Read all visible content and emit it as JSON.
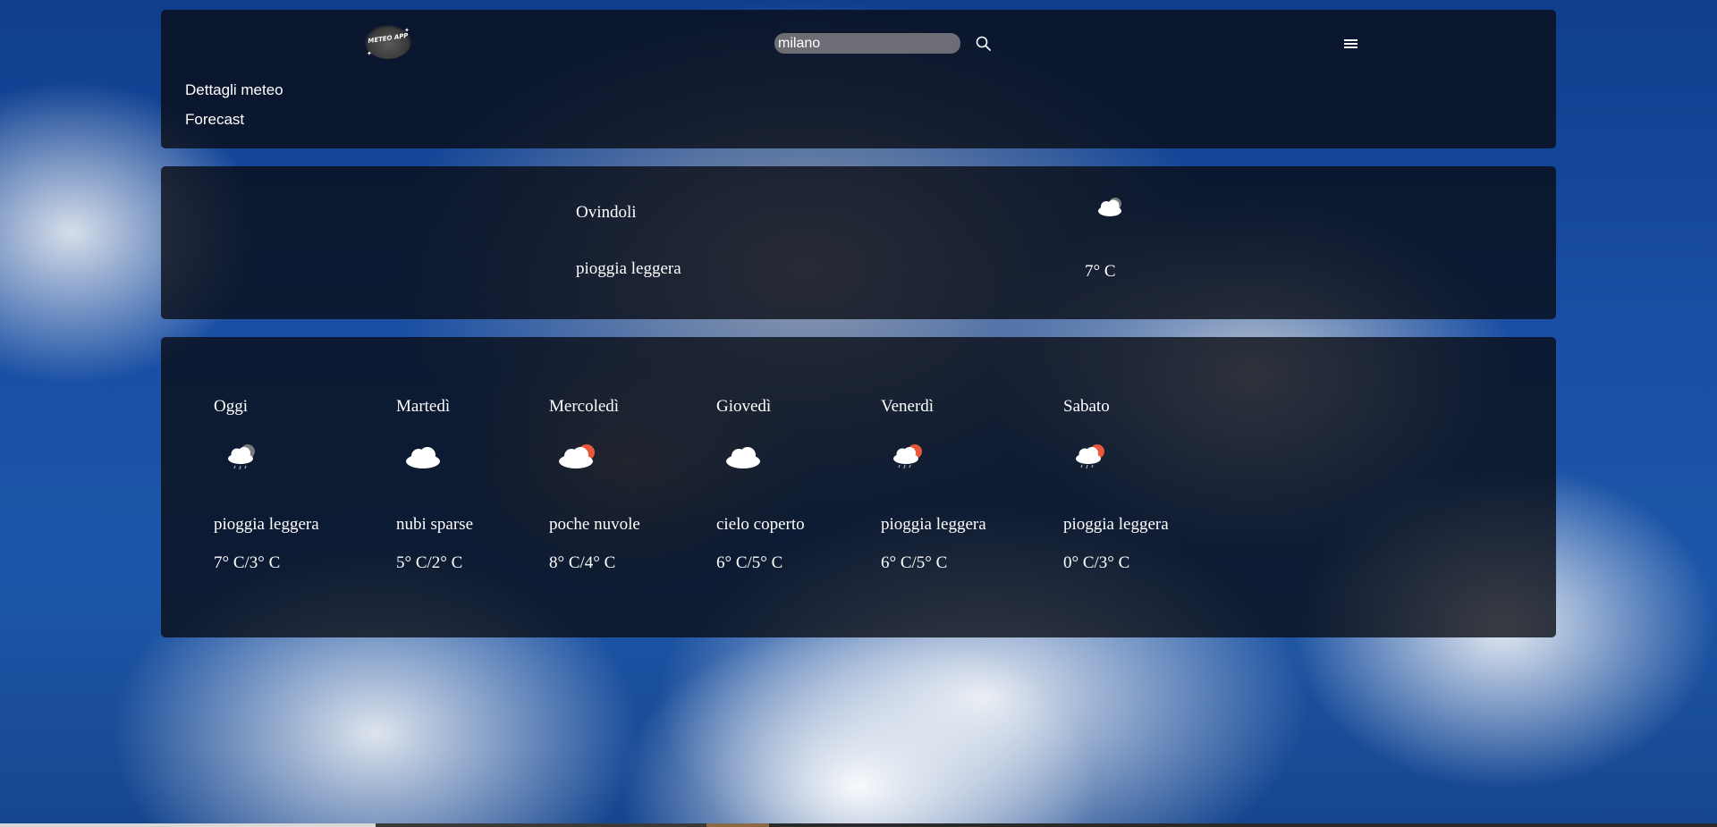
{
  "header": {
    "logo_text": "METEO APP",
    "search": {
      "value": "milano"
    },
    "nav": [
      "Dettagli meteo",
      "Forecast"
    ]
  },
  "current": {
    "city": "Ovindoli",
    "description": "pioggia leggera",
    "temperature": "7° C",
    "icon": "cloud-rain-icon"
  },
  "forecast": [
    {
      "day": "Oggi",
      "description": "pioggia leggera",
      "temps": "7° C/3° C",
      "icon": "cloud-rain-icon"
    },
    {
      "day": "Martedì",
      "description": "nubi sparse",
      "temps": "5° C/2° C",
      "icon": "cloud-icon"
    },
    {
      "day": "Mercoledì",
      "description": "poche nuvole",
      "temps": "8° C/4° C",
      "icon": "cloud-sun-icon"
    },
    {
      "day": "Giovedì",
      "description": "cielo coperto",
      "temps": "6° C/5° C",
      "icon": "cloud-icon"
    },
    {
      "day": "Venerdì",
      "description": "pioggia leggera",
      "temps": "6° C/5° C",
      "icon": "cloud-sun-rain-icon"
    },
    {
      "day": "Sabato",
      "description": "pioggia leggera",
      "temps": "0° C/3° C",
      "icon": "cloud-sun-rain-icon"
    }
  ],
  "colors": {
    "panel_bg": "#080a12",
    "sun": "#e8593a",
    "cloud": "#ffffff"
  }
}
